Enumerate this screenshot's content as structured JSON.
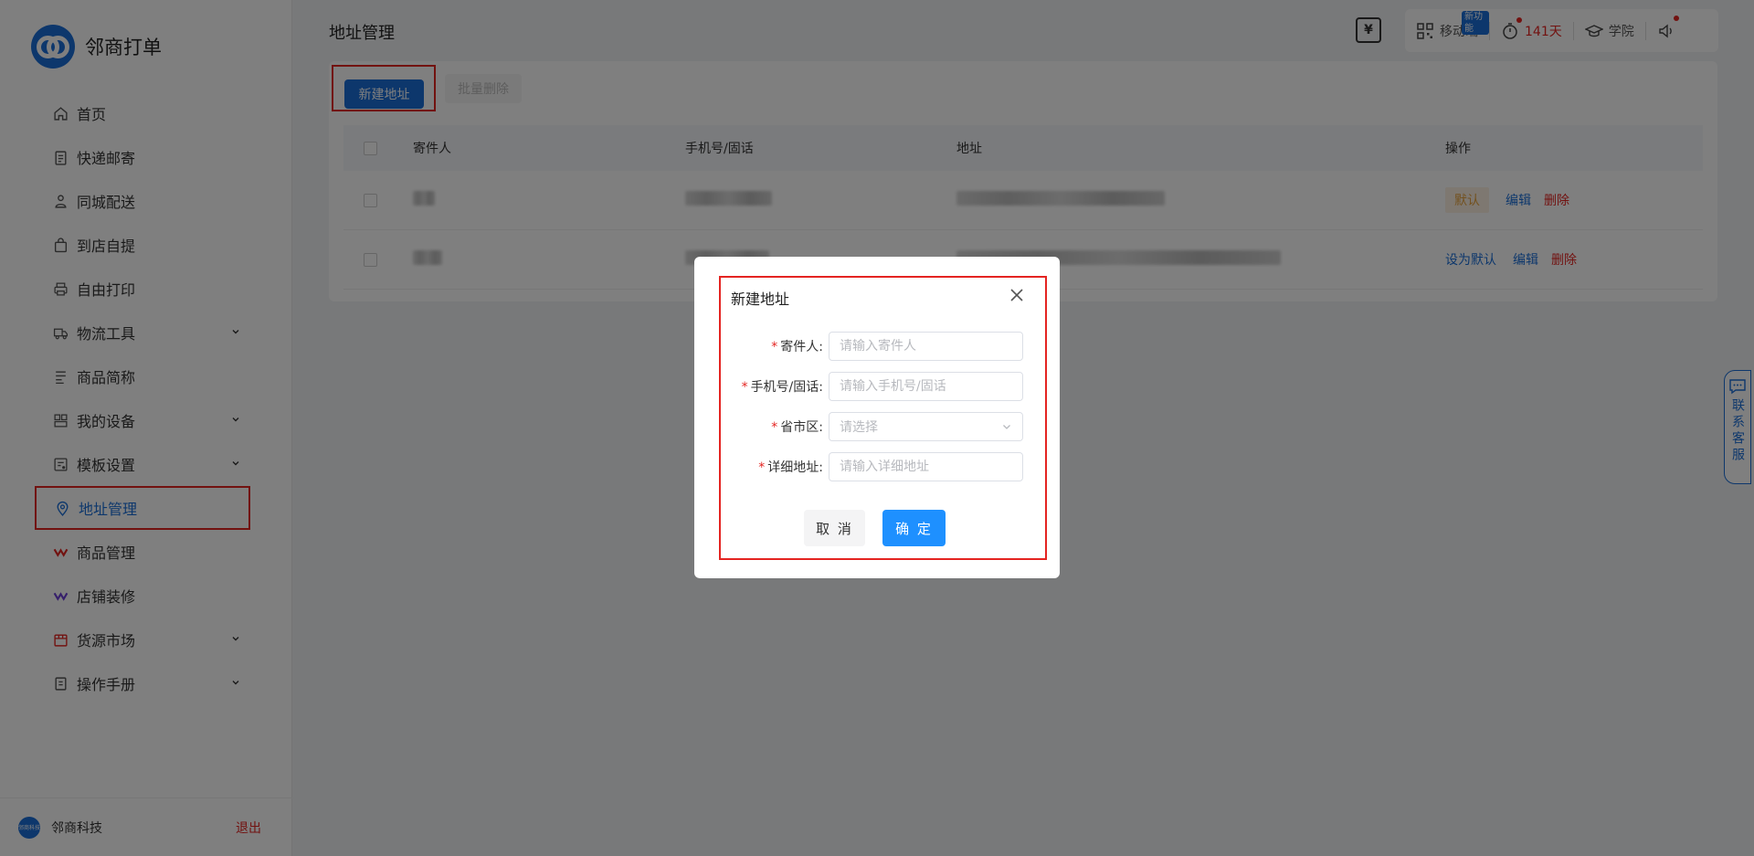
{
  "brand": {
    "name": "邻商打单"
  },
  "sidebar": {
    "items": [
      {
        "label": "首页",
        "icon": "home-icon",
        "has_arrow": false
      },
      {
        "label": "快递邮寄",
        "icon": "clipboard-icon",
        "has_arrow": false
      },
      {
        "label": "同城配送",
        "icon": "courier-icon",
        "has_arrow": false
      },
      {
        "label": "到店自提",
        "icon": "bag-icon",
        "has_arrow": false
      },
      {
        "label": "自由打印",
        "icon": "printer-icon",
        "has_arrow": false
      },
      {
        "label": "物流工具",
        "icon": "truck-icon",
        "has_arrow": true
      },
      {
        "label": "商品简称",
        "icon": "text-icon",
        "has_arrow": false
      },
      {
        "label": "我的设备",
        "icon": "devices-icon",
        "has_arrow": true
      },
      {
        "label": "模板设置",
        "icon": "template-icon",
        "has_arrow": true
      },
      {
        "label": "地址管理",
        "icon": "location-icon",
        "has_arrow": false,
        "active": true
      },
      {
        "label": "商品管理",
        "icon": "goods-icon",
        "has_arrow": false
      },
      {
        "label": "店铺装修",
        "icon": "shop-icon",
        "has_arrow": false
      },
      {
        "label": "货源市场",
        "icon": "market-icon",
        "has_arrow": true
      },
      {
        "label": "操作手册",
        "icon": "manual-icon",
        "has_arrow": true
      }
    ],
    "footer": {
      "avatar_text": "邻商科技",
      "company": "邻商科技",
      "logout": "退出"
    }
  },
  "header": {
    "title": "地址管理",
    "toolbar": {
      "mobile_label": "移动端",
      "mobile_badge": "新功能",
      "days": "141天",
      "academy_label": "学院"
    }
  },
  "actions": {
    "new_address": "新建地址",
    "batch_delete": "批量删除"
  },
  "table": {
    "columns": [
      "寄件人",
      "手机号/固话",
      "地址",
      "操作"
    ],
    "rows": [
      {
        "ops": {
          "default_tag": "默认",
          "edit": "编辑",
          "delete": "删除"
        }
      },
      {
        "ops": {
          "set_default": "设为默认",
          "edit": "编辑",
          "delete": "删除"
        }
      }
    ]
  },
  "help_tab": {
    "label": "联系客服"
  },
  "modal": {
    "title": "新建地址",
    "fields": {
      "sender": {
        "label": "寄件人:",
        "placeholder": "请输入寄件人"
      },
      "phone": {
        "label": "手机号/固话:",
        "placeholder": "请输入手机号/固话"
      },
      "region": {
        "label": "省市区:",
        "placeholder": "请选择"
      },
      "detail": {
        "label": "详细地址:",
        "placeholder": "请输入详细地址"
      }
    },
    "cancel": "取 消",
    "confirm": "确 定"
  },
  "colors": {
    "primary": "#1b6fd8",
    "danger": "#e42421",
    "warning": "#e6a23c",
    "confirm": "#1e90ff"
  }
}
